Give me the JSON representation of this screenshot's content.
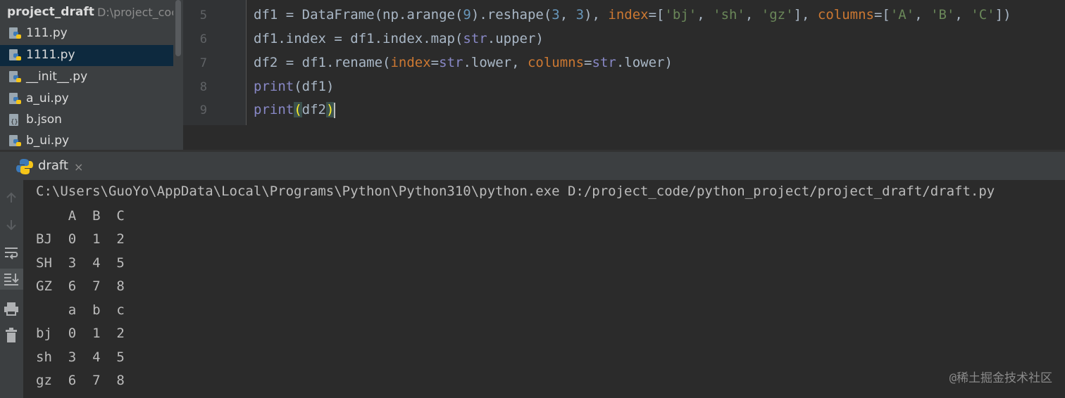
{
  "project_tree": {
    "root_name": "project_draft",
    "root_path": "D:\\project_coc",
    "items": [
      {
        "label": "111.py",
        "icon": "python-file-icon"
      },
      {
        "label": "1111.py",
        "icon": "python-file-icon",
        "selected": true
      },
      {
        "label": "__init__.py",
        "icon": "python-file-icon"
      },
      {
        "label": "a_ui.py",
        "icon": "python-file-icon"
      },
      {
        "label": "b.json",
        "icon": "json-file-icon"
      },
      {
        "label": "b_ui.py",
        "icon": "python-file-icon"
      }
    ]
  },
  "editor": {
    "line_numbers": [
      "5",
      "6",
      "7",
      "8",
      "9"
    ],
    "lines": [
      "df1 = DataFrame(np.arange(9).reshape(3, 3), index=['bj', 'sh', 'gz'], columns=['A', 'B', 'C'])",
      "df1.index = df1.index.map(str.upper)",
      "df2 = df1.rename(index=str.lower, columns=str.lower)",
      "print(df1)",
      "print(df2)"
    ]
  },
  "run_panel": {
    "tab_label": "draft",
    "tab_close": "×",
    "console_lines": [
      "C:\\Users\\GuoYo\\AppData\\Local\\Programs\\Python\\Python310\\python.exe D:/project_code/python_project/project_draft/draft.py",
      "    A  B  C",
      "BJ  0  1  2",
      "SH  3  4  5",
      "GZ  6  7  8",
      "    a  b  c",
      "bj  0  1  2",
      "sh  3  4  5",
      "gz  6  7  8"
    ],
    "toolbar_icons": [
      "arrow-up-icon",
      "arrow-down-icon",
      "soft-wrap-icon",
      "scroll-to-end-icon",
      "print-icon",
      "trash-icon"
    ]
  },
  "watermark": "@稀土掘金技术社区",
  "colors": {
    "background": "#2b2b2b",
    "panel": "#3c3f41",
    "selection": "#0d293e",
    "accent": "#4a88c7",
    "keyword_param": "#cc7832",
    "number": "#6897bb",
    "string": "#6a8759",
    "builtin": "#8888c6"
  }
}
